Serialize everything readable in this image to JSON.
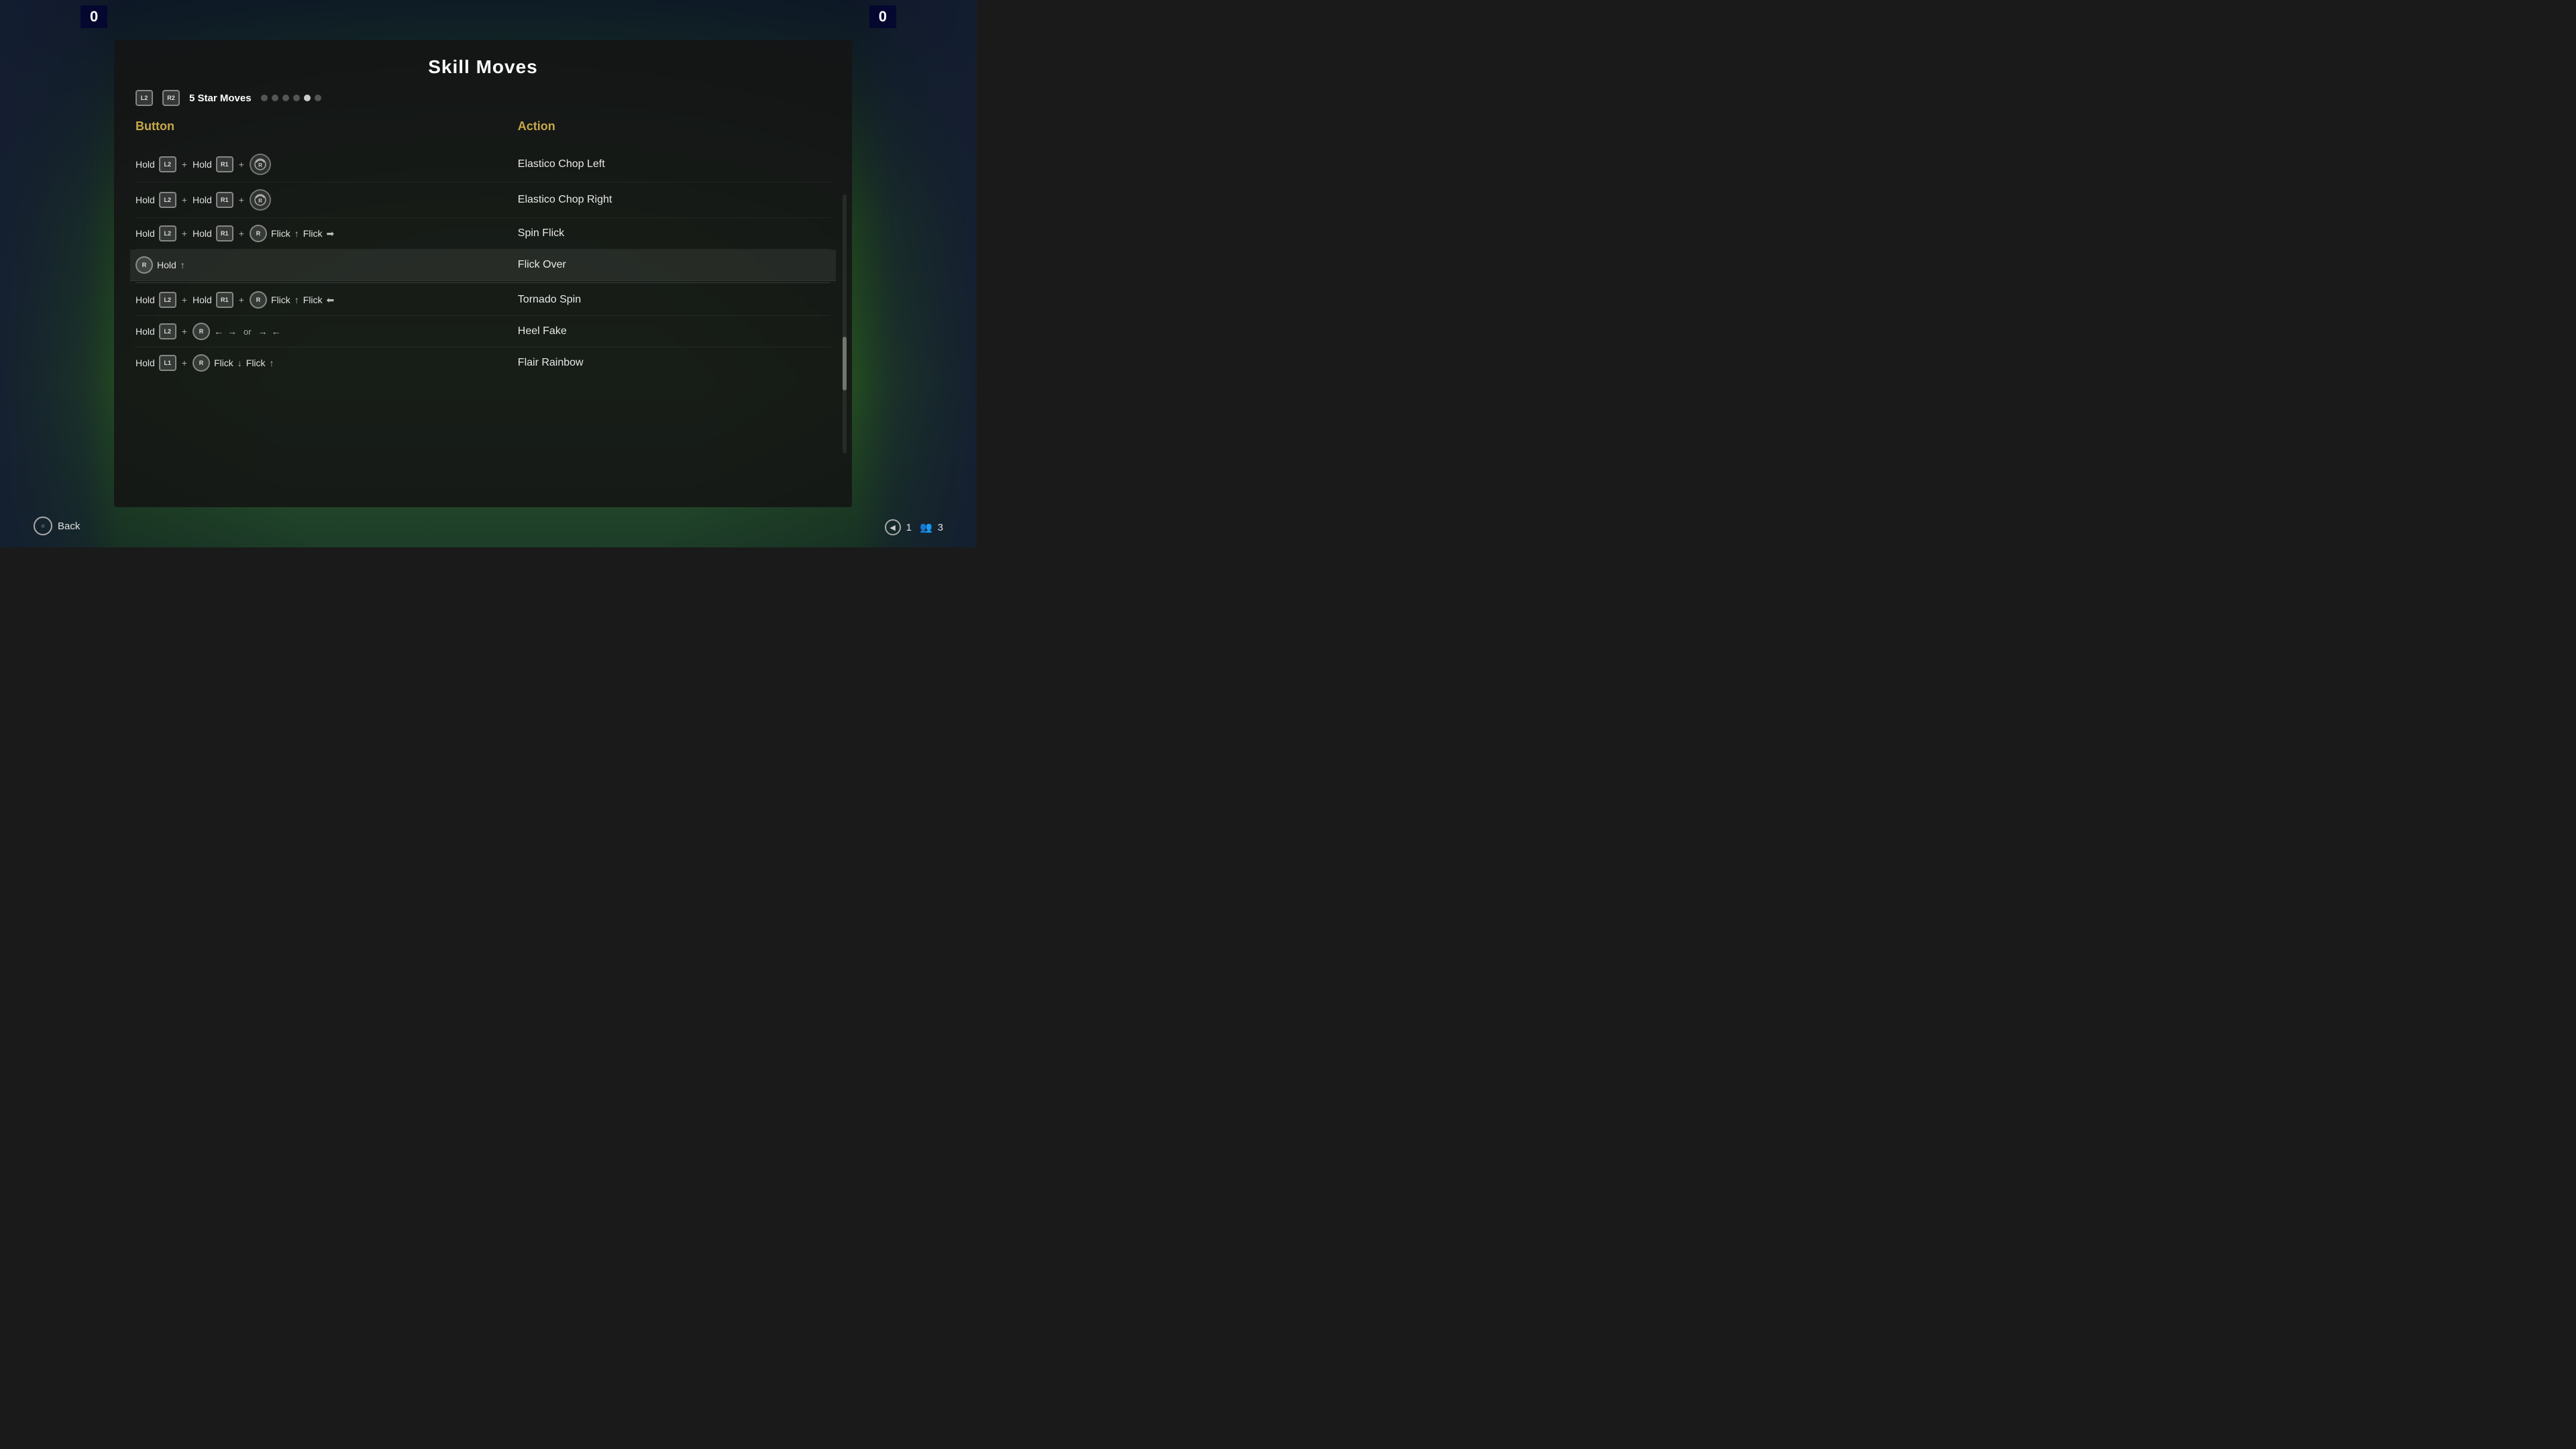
{
  "title": "Skill Moves",
  "tab": {
    "badges": [
      "L2",
      "R2"
    ],
    "label": "5 Star Moves",
    "dots": [
      false,
      false,
      false,
      false,
      true,
      false
    ]
  },
  "columns": {
    "button_header": "Button",
    "action_header": "Action"
  },
  "moves": [
    {
      "id": 1,
      "button_desc": "Hold L2 + Hold R1 + R (rotate-ccw)",
      "action": "Elastico Chop Left",
      "highlighted": false
    },
    {
      "id": 2,
      "button_desc": "Hold L2 + Hold R1 + R (rotate-cw)",
      "action": "Elastico Chop Right",
      "highlighted": false
    },
    {
      "id": 3,
      "button_desc": "Hold L2 + Hold R1 + R Flick ↑ Flick →",
      "action": "Spin Flick",
      "highlighted": false
    },
    {
      "id": 4,
      "button_desc": "R Hold ↑",
      "action": "Flick Over",
      "highlighted": true
    },
    {
      "id": 5,
      "button_desc": "Hold L2 + Hold R1 + R Flick ↑ Flick ←",
      "action": "Tornado Spin",
      "highlighted": false
    },
    {
      "id": 6,
      "button_desc": "Hold L2 + R ← → or → ←",
      "action": "Heel Fake",
      "highlighted": false
    },
    {
      "id": 7,
      "button_desc": "Hold L1 + R Flick ↓ Flick ↑",
      "action": "Flair Rainbow",
      "highlighted": false
    }
  ],
  "back_button": {
    "label": "Back",
    "icon": "○"
  },
  "player_count": {
    "count_icon": "◀",
    "player_num": "1",
    "group_icon": "👥",
    "group_num": "3"
  },
  "score_left": "0",
  "score_right": "0",
  "words": {
    "hold": "Hold",
    "plus": "+",
    "flick": "Flick",
    "or": "or"
  }
}
